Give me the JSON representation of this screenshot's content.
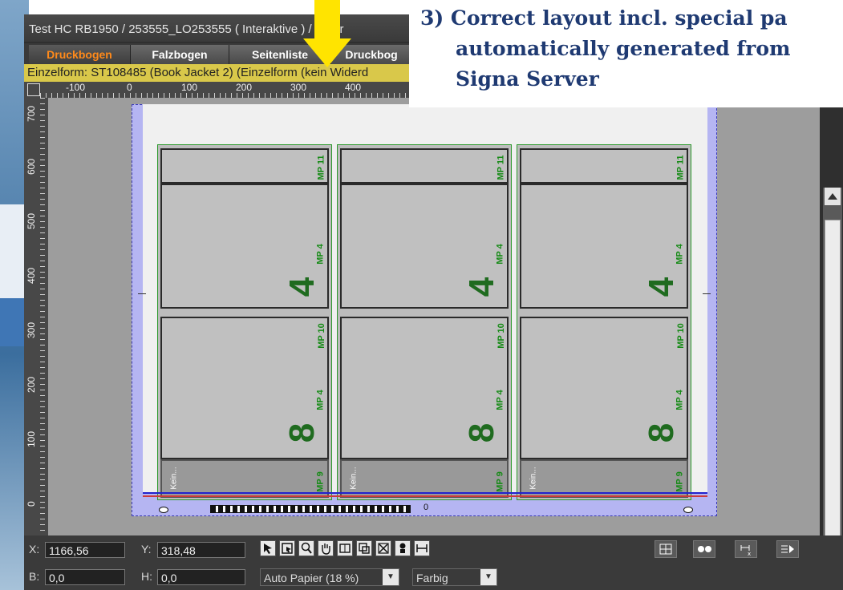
{
  "window": {
    "title": "Test HC RB1950 / 253555_LO253555 ( Interaktive ) / Teilpr"
  },
  "tabs": [
    {
      "label": "Druckbogen",
      "active": true
    },
    {
      "label": "Falzbogen",
      "active": false
    },
    {
      "label": "Seitenliste",
      "active": false
    },
    {
      "label": "Druckbog",
      "active": false
    }
  ],
  "infobar": {
    "text": "Einzelform:  ST108485 (Book Jacket 2) (Einzelform (kein Widerd"
  },
  "ruler": {
    "h_labels": [
      "-100",
      "0",
      "100",
      "200",
      "300",
      "400"
    ],
    "v_labels": [
      "700",
      "600",
      "500",
      "400",
      "300",
      "200",
      "100",
      "0"
    ]
  },
  "annotation": {
    "line1": "3) Correct layout incl. special pa",
    "line2": "automatically generated from",
    "line3": "Signa Server"
  },
  "sheet": {
    "columns": 3,
    "mp_top": "MP 11",
    "mp_mid": "MP 4",
    "mp_lower": "MP 10",
    "mp_low2": "MP 4",
    "mp_bottom": "MP 9",
    "big_4": "4",
    "big_8": "8",
    "kein": "Kein...",
    "scale_zero": "0"
  },
  "status": {
    "x_label": "X:",
    "x_value": "1166,56",
    "y_label": "Y:",
    "y_value": "318,48",
    "b_label": "B:",
    "b_value": "0,0",
    "h_label": "H:",
    "h_value": "0,0",
    "paper_select": "Auto Papier (18 %)",
    "color_select": "Farbig"
  },
  "colors": {
    "accent_tab": "#ff8a1a",
    "infobar": "#d9c84a",
    "annotation_text": "#1f3a72",
    "arrow": "#ffe400",
    "mark_green": "#158a15"
  }
}
